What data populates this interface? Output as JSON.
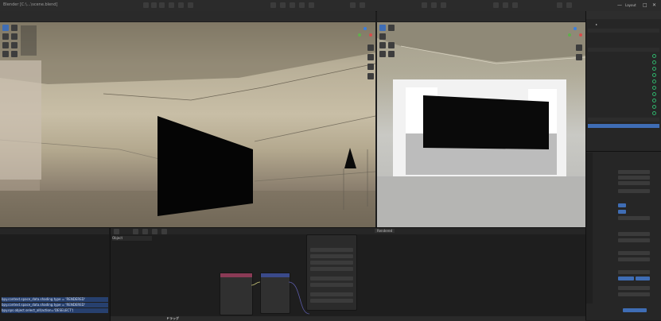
{
  "window": {
    "title": "Blender [C:\\...\\scene.blend]",
    "tab": "Layout",
    "controls": {
      "minimize": "—",
      "maximize": "□",
      "close": "✕"
    }
  },
  "bottom_info": {
    "lines": [
      "bpy.context.space_data.shading.type = 'RENDERED'",
      "bpy.context.space_data.shading.type = 'RENDERED'",
      "bpy.ops.object.select_all(action='DESELECT')"
    ]
  },
  "bottom_strip": {
    "text": "ドラッグ"
  },
  "node_editor": {
    "header_label": "Object"
  },
  "viewport_right": {
    "mode_label": "Rendered"
  },
  "colors": {
    "active_blue": "#3f6db5",
    "node_pink": "#8a3a55",
    "node_blue": "#3a4a8a",
    "eye_green": "#2fb36b"
  },
  "icons": [
    "select-icon",
    "move-icon",
    "rotate-icon",
    "scale-icon",
    "camera-icon",
    "gizmo-icon",
    "eye-icon",
    "outliner-icon",
    "properties-icon"
  ]
}
